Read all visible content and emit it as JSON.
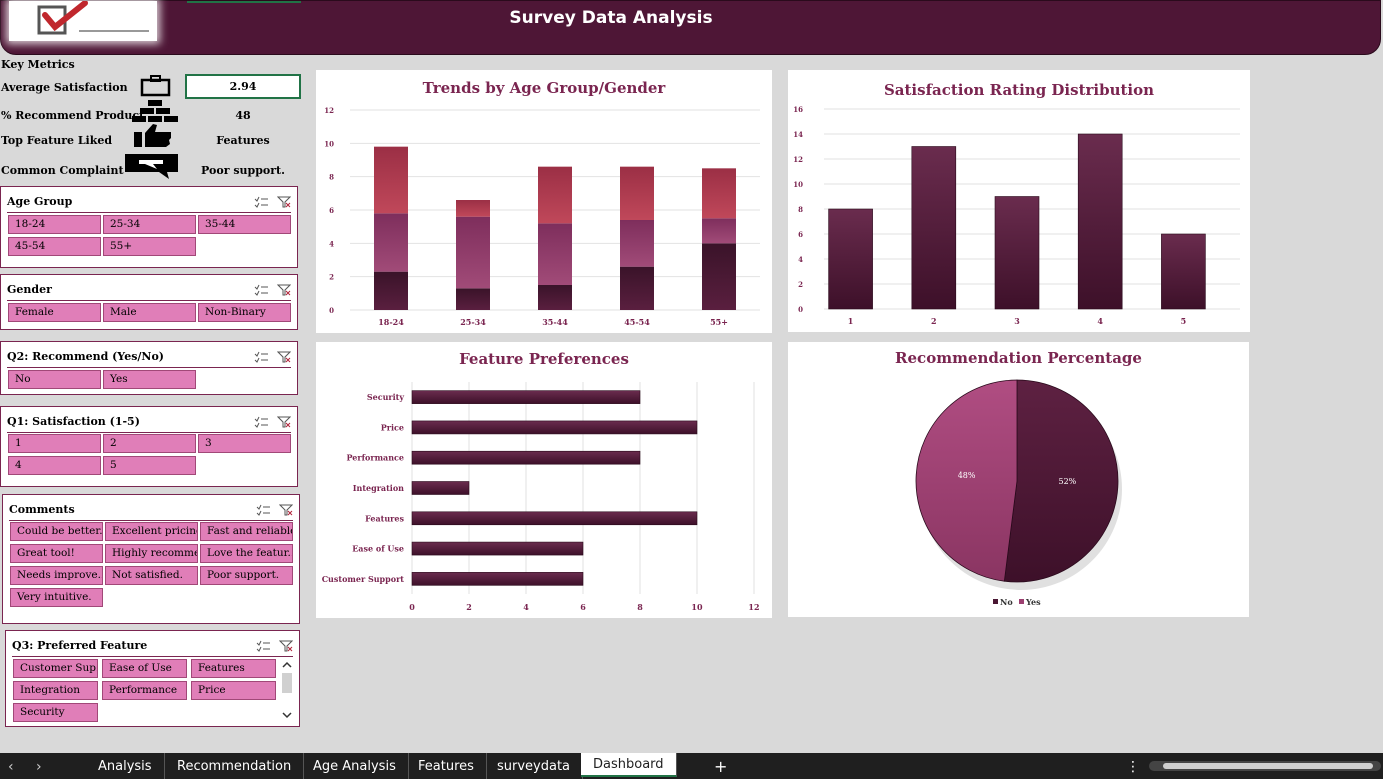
{
  "header": {
    "title": "Survey Data Analysis"
  },
  "key_metrics": {
    "heading": "Key Metrics",
    "avg_satisfaction_label": "Average Satisfaction",
    "avg_satisfaction_value": "2.94",
    "recommend_label": "% Recommend Product",
    "recommend_value": "48",
    "top_feature_label": "Top Feature Liked",
    "top_feature_value": "Features",
    "complaint_label": "Common Complaint",
    "complaint_value": "Poor support."
  },
  "slicers": {
    "age": {
      "title": "Age Group",
      "items": [
        "18-24",
        "25-34",
        "35-44",
        "45-54",
        "55+"
      ]
    },
    "gender": {
      "title": "Gender",
      "items": [
        "Female",
        "Male",
        "Non-Binary"
      ]
    },
    "recommend": {
      "title": "Q2: Recommend (Yes/No)",
      "items": [
        "No",
        "Yes"
      ]
    },
    "satisfaction": {
      "title": "Q1: Satisfaction (1-5)",
      "items": [
        "1",
        "2",
        "3",
        "4",
        "5"
      ]
    },
    "comments": {
      "title": "Comments",
      "items": [
        "Could be better.",
        "Excellent pricing.",
        "Fast and reliable.",
        "Great tool!",
        "Highly recomme...",
        "Love the featur...",
        "Needs improve...",
        "Not satisfied.",
        "Poor support.",
        "Very intuitive."
      ]
    },
    "feature": {
      "title": "Q3: Preferred Feature",
      "items": [
        "Customer Sup...",
        "Ease of Use",
        "Features",
        "Integration",
        "Performance",
        "Price",
        "Security"
      ]
    }
  },
  "colors": {
    "header": "#4e1636",
    "chip": "#e07eb8",
    "title": "#7a2550",
    "bar": "#5a1a3e"
  },
  "chart_data": [
    {
      "type": "bar",
      "stacked": true,
      "title": "Trends by Age Group/Gender",
      "categories": [
        "18-24",
        "25-34",
        "35-44",
        "45-54",
        "55+"
      ],
      "series": [
        {
          "values": [
            2.3,
            1.3,
            1.5,
            2.6,
            4.0
          ]
        },
        {
          "values": [
            3.5,
            4.3,
            3.7,
            2.8,
            1.5
          ]
        },
        {
          "values": [
            4.0,
            1.0,
            3.4,
            3.2,
            3.0
          ]
        }
      ],
      "ylim": [
        0,
        12
      ],
      "yticks": [
        0,
        2,
        4,
        6,
        8,
        10,
        12
      ]
    },
    {
      "type": "bar",
      "title": "Satisfaction Rating Distribution",
      "categories": [
        "1",
        "2",
        "3",
        "4",
        "5"
      ],
      "values": [
        8,
        13,
        9,
        14,
        6
      ],
      "ylim": [
        0,
        16
      ],
      "yticks": [
        0,
        2,
        4,
        6,
        8,
        10,
        12,
        14,
        16
      ]
    },
    {
      "type": "bar",
      "orientation": "horizontal",
      "title": "Feature Preferences",
      "categories": [
        "Security",
        "Price",
        "Performance",
        "Integration",
        "Features",
        "Ease of Use",
        "Customer Support"
      ],
      "values": [
        8,
        10,
        8,
        2,
        10,
        6,
        6
      ],
      "xlim": [
        0,
        12
      ],
      "xticks": [
        0,
        2,
        4,
        6,
        8,
        10,
        12
      ]
    },
    {
      "type": "pie",
      "title": "Recommendation Percentage",
      "labels": [
        "No",
        "Yes"
      ],
      "values": [
        52,
        48
      ],
      "value_labels": [
        "52%",
        "48%"
      ],
      "legend": "bottom"
    }
  ],
  "tabs": [
    "Analysis",
    "Recommendation",
    "Age Analysis",
    "Features",
    "surveydata",
    "Dashboard"
  ],
  "active_tab": "Dashboard",
  "tab_add_label": "+",
  "tab_more_label": "⋮"
}
